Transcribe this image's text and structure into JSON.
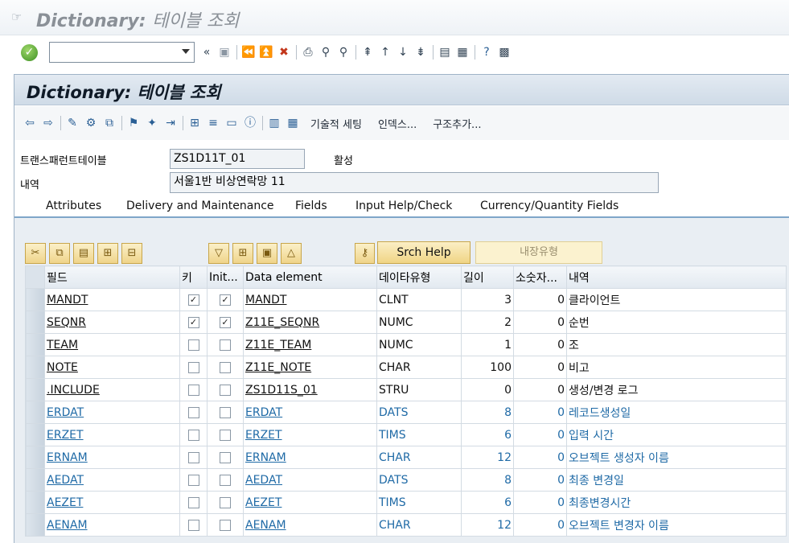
{
  "window": {
    "title_en": "Dictionary:",
    "title_ko": "테이블 조회"
  },
  "command_field": {
    "value": ""
  },
  "screen": {
    "title_en": "Dictionary:",
    "title_ko": "테이블 조회"
  },
  "app_toolbar": {
    "tech_settings": "기술적 세팅",
    "indexes": "인덱스...",
    "append_structure": "구조추가..."
  },
  "header": {
    "transparent_table_label": "트랜스패런트테이블",
    "table_name": "ZS1D11T_01",
    "status": "활성",
    "description_label": "내역",
    "description": "서울1반 비상연락망 11"
  },
  "tabs": [
    {
      "label": "Attributes"
    },
    {
      "label": "Delivery and Maintenance"
    },
    {
      "label": "Fields"
    },
    {
      "label": "Input Help/Check"
    },
    {
      "label": "Currency/Quantity Fields"
    }
  ],
  "table_toolbar": {
    "srch_help": "Srch Help",
    "builtin_type": "내장유형"
  },
  "grid": {
    "columns": [
      "필드",
      "키",
      "Init...",
      "Data element",
      "데이타유형",
      "길이",
      "소숫자...",
      "내역"
    ],
    "rows": [
      {
        "field": "MANDT",
        "key": true,
        "init": true,
        "data_element": "MANDT",
        "type": "CLNT",
        "length": "3",
        "decimals": "0",
        "desc": "클라이언트",
        "color": "black"
      },
      {
        "field": "SEQNR",
        "key": true,
        "init": true,
        "data_element": "Z11E_SEQNR",
        "type": "NUMC",
        "length": "2",
        "decimals": "0",
        "desc": "순번",
        "color": "black"
      },
      {
        "field": "TEAM",
        "key": false,
        "init": false,
        "data_element": "Z11E_TEAM",
        "type": "NUMC",
        "length": "1",
        "decimals": "0",
        "desc": "조",
        "color": "black"
      },
      {
        "field": "NOTE",
        "key": false,
        "init": false,
        "data_element": "Z11E_NOTE",
        "type": "CHAR",
        "length": "100",
        "decimals": "0",
        "desc": "비고",
        "color": "black"
      },
      {
        "field": ".INCLUDE",
        "key": false,
        "init": false,
        "data_element": "ZS1D11S_01",
        "type": "STRU",
        "length": "0",
        "decimals": "0",
        "desc": "생성/변경 로그",
        "color": "black"
      },
      {
        "field": "ERDAT",
        "key": false,
        "init": false,
        "data_element": "ERDAT",
        "type": "DATS",
        "length": "8",
        "decimals": "0",
        "desc": "레코드생성일",
        "color": "blue"
      },
      {
        "field": "ERZET",
        "key": false,
        "init": false,
        "data_element": "ERZET",
        "type": "TIMS",
        "length": "6",
        "decimals": "0",
        "desc": "입력 시간",
        "color": "blue"
      },
      {
        "field": "ERNAM",
        "key": false,
        "init": false,
        "data_element": "ERNAM",
        "type": "CHAR",
        "length": "12",
        "decimals": "0",
        "desc": "오브젝트 생성자 이름",
        "color": "blue"
      },
      {
        "field": "AEDAT",
        "key": false,
        "init": false,
        "data_element": "AEDAT",
        "type": "DATS",
        "length": "8",
        "decimals": "0",
        "desc": "최종 변경일",
        "color": "blue"
      },
      {
        "field": "AEZET",
        "key": false,
        "init": false,
        "data_element": "AEZET",
        "type": "TIMS",
        "length": "6",
        "decimals": "0",
        "desc": "최종변경시간",
        "color": "blue"
      },
      {
        "field": "AENAM",
        "key": false,
        "init": false,
        "data_element": "AENAM",
        "type": "CHAR",
        "length": "12",
        "decimals": "0",
        "desc": "오브젝트 변경자 이름",
        "color": "blue"
      }
    ]
  },
  "colors": {
    "derived_field_text": "#1f6aa6",
    "tab_underline": "#7fa6c9",
    "button_gold": "#efd48a"
  }
}
